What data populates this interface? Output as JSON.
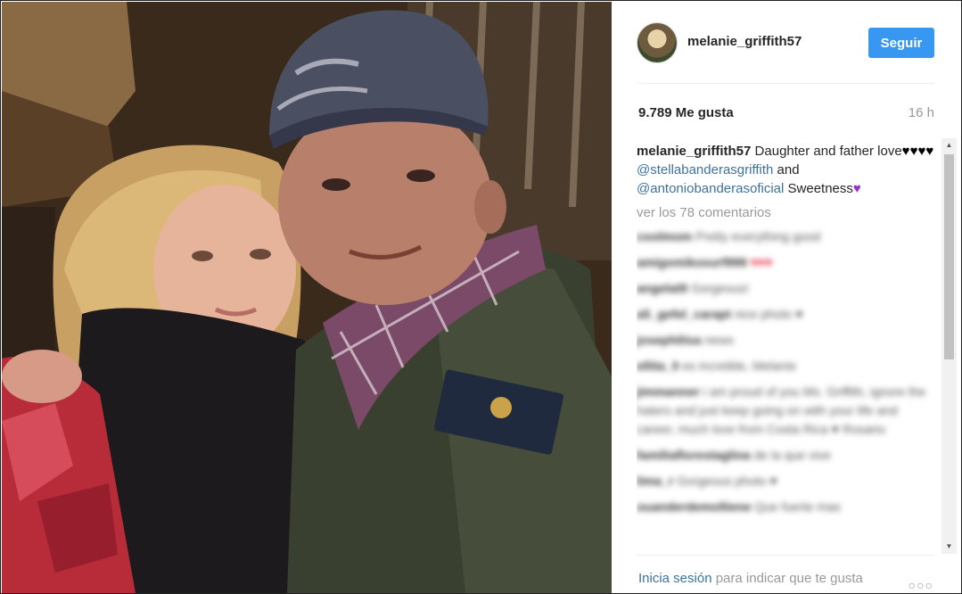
{
  "post": {
    "username": "melanie_griffith57",
    "follow_label": "Seguir",
    "likes": "9.789 Me gusta",
    "time": "16 h",
    "caption": {
      "username": "melanie_griffith57",
      "text_1": "Daughter and father love",
      "hearts": "♥♥♥♥",
      "mention_1": "@stellabanderasgriffith",
      "text_2": "and",
      "mention_2": "@antoniobanderasoficial",
      "text_3": "Sweetness",
      "purple_heart": "♥"
    },
    "view_all_comments": "ver los 78 comentarios",
    "login": {
      "link": "Inicia sesión",
      "text": "para indicar que te gusta"
    },
    "more_options": "○○○"
  },
  "blurred_comments": [
    {
      "user": "coolmom",
      "text": "Pretty everything good"
    },
    {
      "user": "amigomikosurf999",
      "text": "♥♥♥"
    },
    {
      "user": "angelat9",
      "text": "Gorgeous!"
    },
    {
      "user": "a5_gefel_carapt",
      "text": "nice photo ♥"
    },
    {
      "user": "joseph0isa",
      "text": "news"
    },
    {
      "user": "ellita_0",
      "text": "es increible, Melanie"
    },
    {
      "user": "jimmanner",
      "text": "i am proud of you Ms. Griffith, ignore the haters and just keep going on with your life and career, much love from Costa Rica ♥ Rosario"
    },
    {
      "user": "familiaflorestaglina",
      "text": "de la que vive"
    },
    {
      "user": "lima_r",
      "text": "Gorgeous photo ♥"
    },
    {
      "user": "ouanderdemolliene",
      "text": "Que fuerte mas"
    }
  ],
  "colors": {
    "accent": "#3897f0",
    "mention": "#3f729b",
    "muted": "#999999",
    "purple_heart": "#9b2fd1"
  }
}
